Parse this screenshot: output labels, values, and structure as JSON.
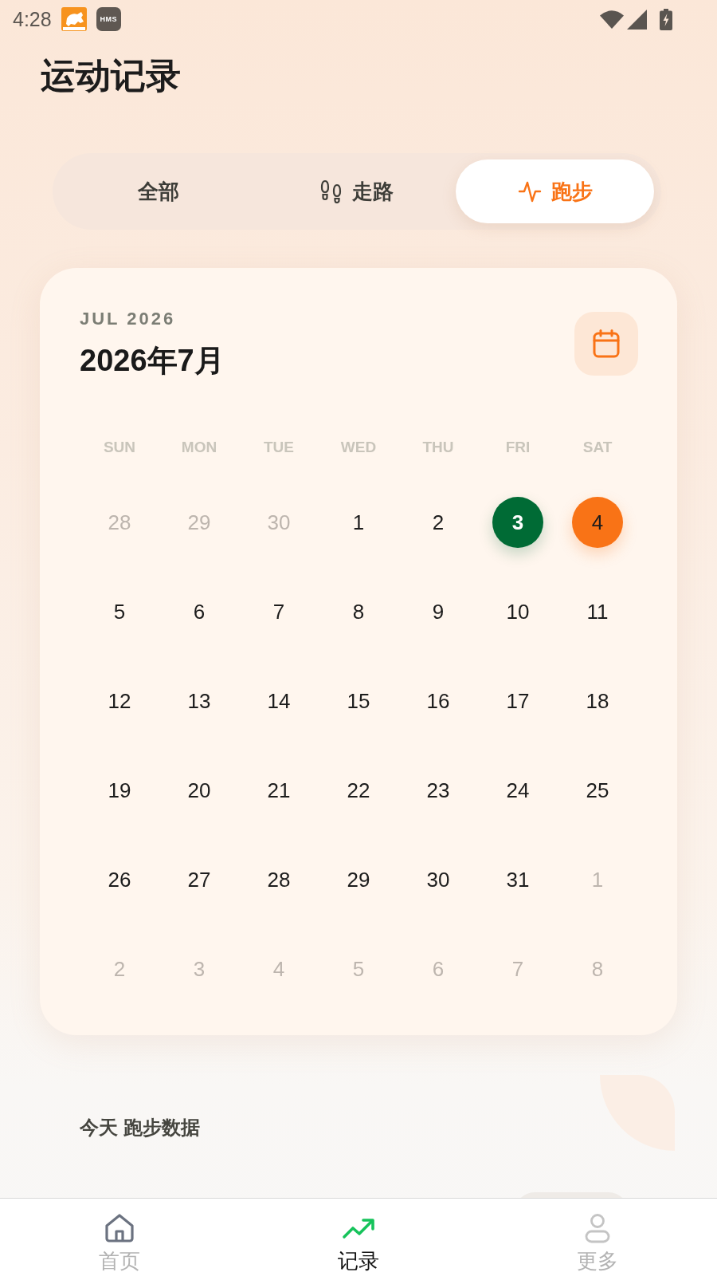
{
  "status_bar": {
    "time": "4:28",
    "app_badge": "HMS"
  },
  "title": "运动记录",
  "tabs": [
    {
      "kind": "all",
      "label": "全部",
      "selected": false
    },
    {
      "kind": "walk",
      "label": "走路",
      "selected": false
    },
    {
      "kind": "run",
      "label": "跑步",
      "selected": true
    }
  ],
  "calendar": {
    "month_code": "JUL 2026",
    "month_title": "2026年7月",
    "weekdays": [
      "SUN",
      "MON",
      "TUE",
      "WED",
      "THU",
      "FRI",
      "SAT"
    ],
    "days": [
      {
        "day": "28",
        "outside_month": true,
        "selected": false,
        "has_record": false
      },
      {
        "day": "29",
        "outside_month": true,
        "selected": false,
        "has_record": false
      },
      {
        "day": "30",
        "outside_month": true,
        "selected": false,
        "has_record": false
      },
      {
        "day": "1",
        "outside_month": false,
        "selected": false,
        "has_record": false
      },
      {
        "day": "2",
        "outside_month": false,
        "selected": false,
        "has_record": false
      },
      {
        "day": "3",
        "outside_month": false,
        "selected": false,
        "has_record": true
      },
      {
        "day": "4",
        "outside_month": false,
        "selected": true,
        "has_record": false
      },
      {
        "day": "5",
        "outside_month": false,
        "selected": false,
        "has_record": false
      },
      {
        "day": "6",
        "outside_month": false,
        "selected": false,
        "has_record": false
      },
      {
        "day": "7",
        "outside_month": false,
        "selected": false,
        "has_record": false
      },
      {
        "day": "8",
        "outside_month": false,
        "selected": false,
        "has_record": false
      },
      {
        "day": "9",
        "outside_month": false,
        "selected": false,
        "has_record": false
      },
      {
        "day": "10",
        "outside_month": false,
        "selected": false,
        "has_record": false
      },
      {
        "day": "11",
        "outside_month": false,
        "selected": false,
        "has_record": false
      },
      {
        "day": "12",
        "outside_month": false,
        "selected": false,
        "has_record": false
      },
      {
        "day": "13",
        "outside_month": false,
        "selected": false,
        "has_record": false
      },
      {
        "day": "14",
        "outside_month": false,
        "selected": false,
        "has_record": false
      },
      {
        "day": "15",
        "outside_month": false,
        "selected": false,
        "has_record": false
      },
      {
        "day": "16",
        "outside_month": false,
        "selected": false,
        "has_record": false
      },
      {
        "day": "17",
        "outside_month": false,
        "selected": false,
        "has_record": false
      },
      {
        "day": "18",
        "outside_month": false,
        "selected": false,
        "has_record": false
      },
      {
        "day": "19",
        "outside_month": false,
        "selected": false,
        "has_record": false
      },
      {
        "day": "20",
        "outside_month": false,
        "selected": false,
        "has_record": false
      },
      {
        "day": "21",
        "outside_month": false,
        "selected": false,
        "has_record": false
      },
      {
        "day": "22",
        "outside_month": false,
        "selected": false,
        "has_record": false
      },
      {
        "day": "23",
        "outside_month": false,
        "selected": false,
        "has_record": false
      },
      {
        "day": "24",
        "outside_month": false,
        "selected": false,
        "has_record": false
      },
      {
        "day": "25",
        "outside_month": false,
        "selected": false,
        "has_record": false
      },
      {
        "day": "26",
        "outside_month": false,
        "selected": false,
        "has_record": false
      },
      {
        "day": "27",
        "outside_month": false,
        "selected": false,
        "has_record": false
      },
      {
        "day": "28",
        "outside_month": false,
        "selected": false,
        "has_record": false
      },
      {
        "day": "29",
        "outside_month": false,
        "selected": false,
        "has_record": false
      },
      {
        "day": "30",
        "outside_month": false,
        "selected": false,
        "has_record": false
      },
      {
        "day": "31",
        "outside_month": false,
        "selected": false,
        "has_record": false
      },
      {
        "day": "1",
        "outside_month": true,
        "selected": false,
        "has_record": false
      },
      {
        "day": "2",
        "outside_month": true,
        "selected": false,
        "has_record": false
      },
      {
        "day": "3",
        "outside_month": true,
        "selected": false,
        "has_record": false
      },
      {
        "day": "4",
        "outside_month": true,
        "selected": false,
        "has_record": false
      },
      {
        "day": "5",
        "outside_month": true,
        "selected": false,
        "has_record": false
      },
      {
        "day": "6",
        "outside_month": true,
        "selected": false,
        "has_record": false
      },
      {
        "day": "7",
        "outside_month": true,
        "selected": false,
        "has_record": false
      },
      {
        "day": "8",
        "outside_month": true,
        "selected": false,
        "has_record": false
      }
    ]
  },
  "today_section": {
    "title": "今天 跑步数据"
  },
  "bottom_nav": [
    {
      "kind": "home",
      "label": "首页",
      "selected": false
    },
    {
      "kind": "records",
      "label": "记录",
      "selected": true
    },
    {
      "kind": "profile",
      "label": "更多",
      "selected": false
    }
  ]
}
